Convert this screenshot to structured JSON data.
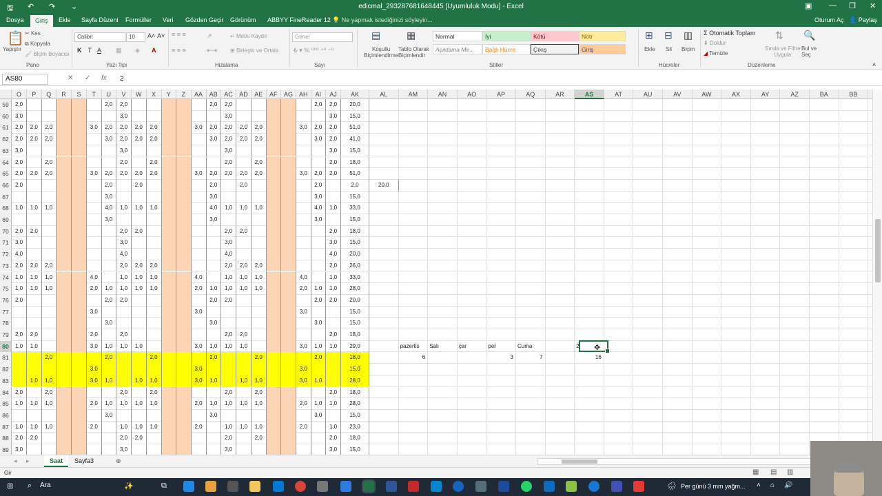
{
  "window": {
    "title": "edicmal_293287681648445 [Uyumluluk Modu] - Excel",
    "quick_access": [
      "save-icon",
      "undo-icon",
      "redo-icon",
      "customize-icon"
    ],
    "controls": [
      "ribbon-display-icon",
      "minimize-icon",
      "restore-icon",
      "close-icon"
    ]
  },
  "menu": {
    "items": [
      "Dosya",
      "Giriş",
      "Ekle",
      "Sayfa Düzeni",
      "Formüller",
      "Veri",
      "Gözden Geçir",
      "Görünüm",
      "ABBYY FineReader 12"
    ],
    "tell_me": "Ne yapmak istediğinizi söyleyin...",
    "signin": "Oturum Aç",
    "share": "Paylaş"
  },
  "ribbon": {
    "clipboard": {
      "paste": "Yapıştır",
      "cut": "Kes",
      "copy": "Kopyala",
      "format_painter": "Biçim Boyacısı",
      "group": "Pano"
    },
    "font": {
      "name": "Calibri",
      "size": "10",
      "bold": "K",
      "italic": "T",
      "underline": "A",
      "group": "Yazı Tipi"
    },
    "alignment": {
      "wrap": "Metni Kaydır",
      "merge": "Birleştir ve Ortala",
      "group": "Hizalama"
    },
    "number": {
      "format": "Genel",
      "group": "Sayı"
    },
    "styles": {
      "conditional": [
        "Koşullu",
        "Biçimlendirme"
      ],
      "table": [
        "Tablo Olarak",
        "Biçimlendir"
      ],
      "cells": [
        "Normal",
        "İyi",
        "Kötü",
        "Nötr",
        "Açıklama Me...",
        "Bağlı Hücre",
        "Çıkış",
        "Giriş"
      ],
      "group": "Stiller"
    },
    "cells": {
      "insert": "Ekle",
      "delete": "Sil",
      "format": "Biçim",
      "group": "Hücreler"
    },
    "editing": {
      "autosum": "Otomatik Toplam",
      "fill": "Doldur",
      "clear": "Temizle",
      "sort": [
        "Sırala ve Filtre",
        "Uygula"
      ],
      "find": [
        "Bul ve",
        "Seç"
      ],
      "group": "Düzenleme"
    }
  },
  "formula_bar": {
    "name_box": "AS80",
    "value": "2",
    "cancel": "✕",
    "enter": "✓",
    "fx": "fx"
  },
  "columns": [
    "O",
    "P",
    "Q",
    "R",
    "S",
    "T",
    "U",
    "V",
    "W",
    "X",
    "Y",
    "Z",
    "AA",
    "AB",
    "AC",
    "AD",
    "AE",
    "AF",
    "AG",
    "AH",
    "AI",
    "AJ",
    "AK",
    "AL",
    "AM",
    "AN",
    "AO",
    "AP",
    "AQ",
    "AR",
    "AS",
    "AT",
    "AU",
    "AV",
    "AW",
    "AX",
    "AY",
    "AZ",
    "BA",
    "BB"
  ],
  "selected_column": "AS",
  "grid_rows": [
    {
      "n": "59",
      "v": [
        "2,0",
        "",
        "",
        "",
        "",
        "",
        "2,0",
        "2,0",
        "",
        "",
        "",
        "",
        "",
        "2,0",
        "2,0",
        "",
        "",
        "",
        "",
        "",
        "2,0",
        "2,0",
        "20,0"
      ]
    },
    {
      "n": "60",
      "v": [
        "3,0",
        "",
        "",
        "",
        "",
        "",
        "",
        "3,0",
        "",
        "",
        "",
        "",
        "",
        "",
        "3,0",
        "",
        "",
        "",
        "",
        "",
        "",
        "3,0",
        "15,0"
      ]
    },
    {
      "n": "61",
      "v": [
        "2,0",
        "2,0",
        "2,0",
        "",
        "",
        "3,0",
        "2,0",
        "2,0",
        "2,0",
        "2,0",
        "",
        "",
        "3,0",
        "2,0",
        "2,0",
        "2,0",
        "2,0",
        "",
        "",
        "3,0",
        "2,0",
        "2,0",
        "51,0"
      ]
    },
    {
      "n": "62",
      "v": [
        "2,0",
        "2,0",
        "2,0",
        "",
        "",
        "",
        "3,0",
        "2,0",
        "2,0",
        "2,0",
        "",
        "",
        "",
        "3,0",
        "2,0",
        "2,0",
        "2,0",
        "",
        "",
        "",
        "3,0",
        "2,0",
        "41,0"
      ]
    },
    {
      "n": "63",
      "v": [
        "3,0",
        "",
        "",
        "",
        "",
        "",
        "",
        "3,0",
        "",
        "",
        "",
        "",
        "",
        "",
        "3,0",
        "",
        "",
        "",
        "",
        "",
        "",
        "3,0",
        "15,0"
      ]
    },
    {
      "n": "64",
      "v": [
        "2,0",
        "",
        "2,0",
        "",
        "",
        "",
        "",
        "2,0",
        "",
        "2,0",
        "",
        "",
        "",
        "",
        "2,0",
        "",
        "2,0",
        "",
        "",
        "",
        "",
        "2,0",
        "18,0"
      ]
    },
    {
      "n": "65",
      "v": [
        "2,0",
        "2,0",
        "2,0",
        "",
        "",
        "3,0",
        "2,0",
        "2,0",
        "2,0",
        "2,0",
        "",
        "",
        "3,0",
        "2,0",
        "2,0",
        "2,0",
        "2,0",
        "",
        "",
        "3,0",
        "2,0",
        "2,0",
        "51,0"
      ]
    },
    {
      "n": "66",
      "v": [
        "2,0",
        "",
        "",
        "",
        "",
        "",
        "2,0",
        "",
        "2,0",
        "",
        "",
        "",
        "",
        "2,0",
        "",
        "2,0",
        "",
        "",
        "",
        "",
        "2,0",
        "",
        "2,0",
        "20,0"
      ]
    },
    {
      "n": "67",
      "v": [
        "",
        "",
        "",
        "",
        "",
        "",
        "3,0",
        "",
        "",
        "",
        "",
        "",
        "",
        "3,0",
        "",
        "",
        "",
        "",
        "",
        "",
        "3,0",
        "",
        "15,0"
      ]
    },
    {
      "n": "68",
      "v": [
        "1,0",
        "1,0",
        "1,0",
        "",
        "",
        "",
        "4,0",
        "1,0",
        "1,0",
        "1,0",
        "",
        "",
        "",
        "4,0",
        "1,0",
        "1,0",
        "1,0",
        "",
        "",
        "",
        "4,0",
        "1,0",
        "33,0"
      ]
    },
    {
      "n": "69",
      "v": [
        "",
        "",
        "",
        "",
        "",
        "",
        "3,0",
        "",
        "",
        "",
        "",
        "",
        "",
        "3,0",
        "",
        "",
        "",
        "",
        "",
        "",
        "3,0",
        "",
        "15,0"
      ]
    },
    {
      "n": "70",
      "v": [
        "2,0",
        "2,0",
        "",
        "",
        "",
        "",
        "",
        "2,0",
        "2,0",
        "",
        "",
        "",
        "",
        "",
        "2,0",
        "2,0",
        "",
        "",
        "",
        "",
        "",
        "2,0",
        "18,0"
      ]
    },
    {
      "n": "71",
      "v": [
        "3,0",
        "",
        "",
        "",
        "",
        "",
        "",
        "3,0",
        "",
        "",
        "",
        "",
        "",
        "",
        "3,0",
        "",
        "",
        "",
        "",
        "",
        "",
        "3,0",
        "15,0"
      ]
    },
    {
      "n": "72",
      "v": [
        "4,0",
        "",
        "",
        "",
        "",
        "",
        "",
        "4,0",
        "",
        "",
        "",
        "",
        "",
        "",
        "4,0",
        "",
        "",
        "",
        "",
        "",
        "",
        "4,0",
        "20,0"
      ]
    },
    {
      "n": "73",
      "v": [
        "2,0",
        "2,0",
        "2,0",
        "",
        "",
        "",
        "",
        "2,0",
        "2,0",
        "2,0",
        "",
        "",
        "",
        "",
        "2,0",
        "2,0",
        "2,0",
        "",
        "",
        "",
        "",
        "2,0",
        "26,0"
      ]
    },
    {
      "n": "74",
      "v": [
        "1,0",
        "1,0",
        "1,0",
        "",
        "",
        "4,0",
        "",
        "1,0",
        "1,0",
        "1,0",
        "",
        "",
        "4,0",
        "",
        "1,0",
        "1,0",
        "1,0",
        "",
        "",
        "4,0",
        "",
        "1,0",
        "33,0"
      ]
    },
    {
      "n": "75",
      "v": [
        "1,0",
        "1,0",
        "1,0",
        "",
        "",
        "2,0",
        "1,0",
        "1,0",
        "1,0",
        "1,0",
        "",
        "",
        "2,0",
        "1,0",
        "1,0",
        "1,0",
        "1,0",
        "",
        "",
        "2,0",
        "1,0",
        "1,0",
        "28,0"
      ]
    },
    {
      "n": "76",
      "v": [
        "2,0",
        "",
        "",
        "",
        "",
        "",
        "2,0",
        "2,0",
        "",
        "",
        "",
        "",
        "",
        "2,0",
        "2,0",
        "",
        "",
        "",
        "",
        "",
        "2,0",
        "2,0",
        "20,0"
      ]
    },
    {
      "n": "77",
      "v": [
        "",
        "",
        "",
        "",
        "",
        "3,0",
        "",
        "",
        "",
        "",
        "",
        "",
        "3,0",
        "",
        "",
        "",
        "",
        "",
        "",
        "3,0",
        "",
        "",
        "15,0"
      ]
    },
    {
      "n": "78",
      "v": [
        "",
        "",
        "",
        "",
        "",
        "",
        "3,0",
        "",
        "",
        "",
        "",
        "",
        "",
        "3,0",
        "",
        "",
        "",
        "",
        "",
        "",
        "3,0",
        "",
        "15,0"
      ]
    },
    {
      "n": "79",
      "v": [
        "2,0",
        "2,0",
        "",
        "",
        "",
        "2,0",
        "",
        "2,0",
        "",
        "",
        "",
        "",
        "",
        "",
        "2,0",
        "2,0",
        "",
        "",
        "",
        "",
        "",
        "2,0",
        "18,0"
      ]
    },
    {
      "n": "80",
      "v": [
        "1,0",
        "1,0",
        "",
        "",
        "",
        "3,0",
        "1,0",
        "1,0",
        "1,0",
        "",
        "",
        "",
        "3,0",
        "1,0",
        "1,0",
        "1,0",
        "",
        "",
        "",
        "3,0",
        "1,0",
        "1,0",
        "29,0"
      ]
    },
    {
      "n": "81",
      "v": [
        "",
        "",
        "2,0",
        "",
        "",
        "",
        "2,0",
        "",
        "",
        "2,0",
        "",
        "",
        "",
        "2,0",
        "",
        "",
        "2,0",
        "",
        "",
        "",
        "2,0",
        "",
        "18,0"
      ]
    },
    {
      "n": "82",
      "v": [
        "",
        "",
        "",
        "",
        "",
        "3,0",
        "",
        "",
        "",
        "",
        "",
        "",
        "3,0",
        "",
        "",
        "",
        "",
        "",
        "",
        "3,0",
        "",
        "",
        "15,0"
      ]
    },
    {
      "n": "83",
      "v": [
        "",
        "1,0",
        "1,0",
        "",
        "",
        "3,0",
        "1,0",
        "",
        "1,0",
        "1,0",
        "",
        "",
        "3,0",
        "1,0",
        "",
        "1,0",
        "1,0",
        "",
        "",
        "3,0",
        "1,0",
        "",
        "28,0"
      ]
    },
    {
      "n": "84",
      "v": [
        "2,0",
        "",
        "2,0",
        "",
        "",
        "",
        "",
        "2,0",
        "",
        "2,0",
        "",
        "",
        "",
        "",
        "2,0",
        "",
        "2,0",
        "",
        "",
        "",
        "",
        "2,0",
        "18,0"
      ]
    },
    {
      "n": "85",
      "v": [
        "1,0",
        "1,0",
        "1,0",
        "",
        "",
        "2,0",
        "1,0",
        "1,0",
        "1,0",
        "1,0",
        "",
        "",
        "2,0",
        "1,0",
        "1,0",
        "1,0",
        "1,0",
        "",
        "",
        "2,0",
        "1,0",
        "1,0",
        "28,0"
      ]
    },
    {
      "n": "86",
      "v": [
        "",
        "",
        "",
        "",
        "",
        "",
        "3,0",
        "",
        "",
        "",
        "",
        "",
        "",
        "3,0",
        "",
        "",
        "",
        "",
        "",
        "",
        "3,0",
        "",
        "15,0"
      ]
    },
    {
      "n": "87",
      "v": [
        "1,0",
        "1,0",
        "1,0",
        "",
        "",
        "2,0",
        "",
        "1,0",
        "1,0",
        "1,0",
        "",
        "",
        "2,0",
        "",
        "1,0",
        "1,0",
        "1,0",
        "",
        "",
        "2,0",
        "",
        "1,0",
        "23,0"
      ]
    },
    {
      "n": "88",
      "v": [
        "2,0",
        "2,0",
        "",
        "",
        "",
        "",
        "",
        "2,0",
        "2,0",
        "",
        "",
        "",
        "",
        "",
        "2,0",
        "",
        "2,0",
        "",
        "",
        "",
        "",
        "2,0",
        "18,0"
      ]
    },
    {
      "n": "89",
      "v": [
        "3,0",
        "",
        "",
        "",
        "",
        "",
        "",
        "3,0",
        "",
        "",
        "",
        "",
        "",
        "",
        "3,0",
        "",
        "",
        "",
        "",
        "",
        "",
        "3,0",
        "15,0"
      ]
    }
  ],
  "highlight_rows": [
    "81",
    "82",
    "83"
  ],
  "orange_columns": [
    "R",
    "S",
    "Y",
    "Z",
    "AF",
    "AG"
  ],
  "side_table": {
    "row80": {
      "AM": "pazertis",
      "AN": "Salı",
      "AO": "çar",
      "AP": "per",
      "AQ": "Cuma",
      "AS": "2"
    },
    "row81": {
      "AM": "6",
      "AP": "3",
      "AQ": "7",
      "AS": "16"
    }
  },
  "sheet_tabs": [
    "Saat",
    "Sayfa3"
  ],
  "active_sheet": "Saat",
  "status": {
    "mode": "Gir"
  },
  "taskbar": {
    "search": "Ara",
    "weather": "Per günü 3 mm yağm..."
  },
  "colors": {
    "excel_green": "#217346",
    "orange_fill": "#fcd5b4",
    "yellow_fill": "#ffff00"
  }
}
